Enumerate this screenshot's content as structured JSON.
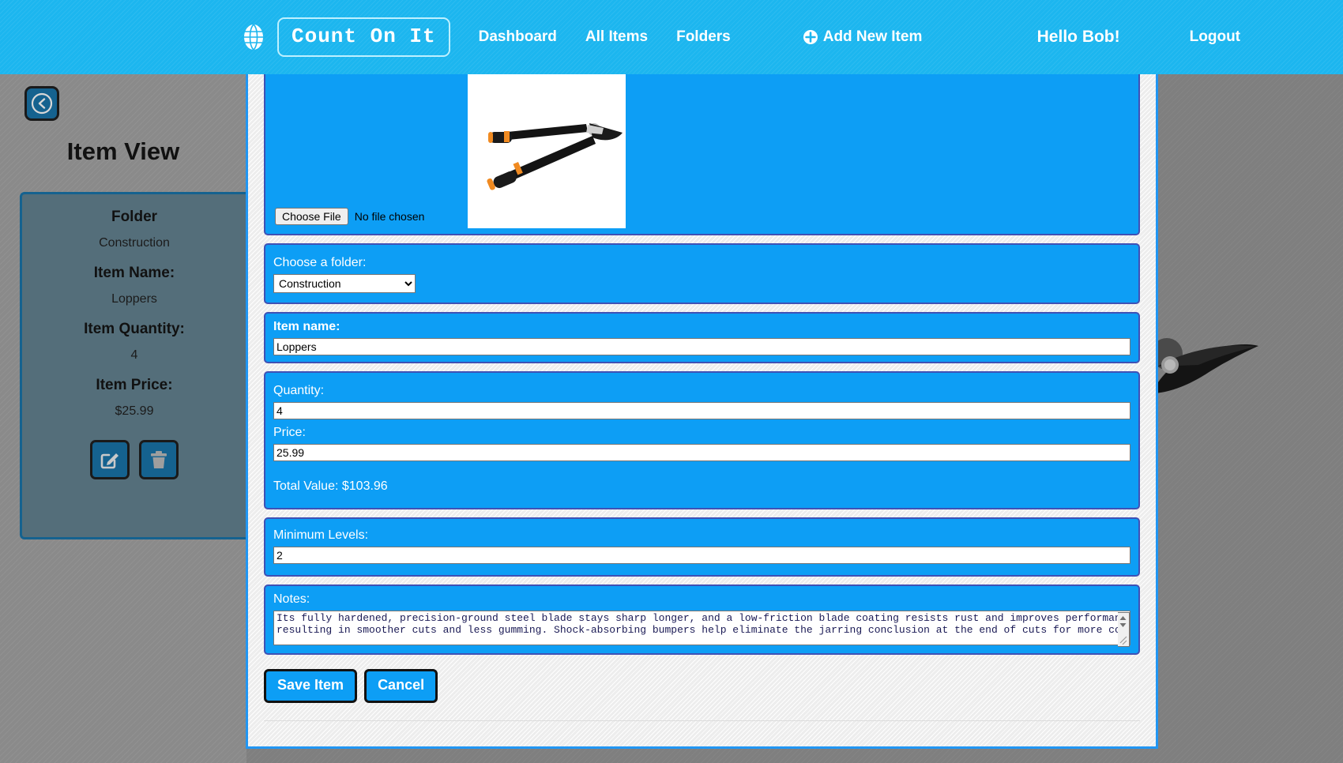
{
  "navbar": {
    "globe_icon": "globe-icon",
    "brand": "Count On It",
    "links": [
      {
        "label": "Dashboard",
        "name": "dashboard"
      },
      {
        "label": "All Items",
        "name": "all-items"
      },
      {
        "label": "Folders",
        "name": "folders"
      }
    ],
    "add_new_item": {
      "label": "Add New Item",
      "icon": "plus-circle-icon"
    },
    "greeting": "Hello Bob!",
    "logout": "Logout",
    "background_color": "#1cb6ef"
  },
  "sidebar": {
    "back_button_icon": "arrow-left-circle-icon",
    "title": "Item View",
    "card": {
      "fields": [
        {
          "label": "Folder",
          "value": "Construction"
        },
        {
          "label": "Item Name:",
          "value": "Loppers"
        },
        {
          "label": "Item Quantity:",
          "value": "4"
        },
        {
          "label": "Item Price:",
          "value": "$25.99"
        }
      ],
      "actions": [
        {
          "name": "edit-item-button",
          "icon": "pencil-square-icon"
        },
        {
          "name": "delete-item-button",
          "icon": "trash-icon"
        }
      ]
    },
    "card_color": "#546e7a",
    "border_color": "#15628f"
  },
  "form": {
    "image": {
      "file_button_label": "Choose File",
      "file_status": "No file chosen",
      "photo_alt": "loppers-product-photo"
    },
    "folder": {
      "label": "Choose a folder:",
      "selected": "Construction",
      "options": [
        "Construction"
      ]
    },
    "item_name": {
      "label": "Item name:",
      "value": "Loppers"
    },
    "quantity": {
      "label": "Quantity:",
      "value": "4"
    },
    "price": {
      "label": "Price:",
      "value": "25.99"
    },
    "total_value": "Total Value: $103.96",
    "minimum_levels": {
      "label": "Minimum Levels:",
      "value": "2"
    },
    "notes": {
      "label": "Notes:",
      "value": "Its fully hardened, precision-ground steel blade stays sharp longer, and a low-friction blade coating resists rust and improves performance,\nresulting in smoother cuts and less gumming. Shock-absorbing bumpers help eliminate the jarring conclusion at the end of cuts for more comfortable"
    },
    "save_label": "Save Item",
    "cancel_label": "Cancel",
    "panel_color": "#0d9ef5",
    "panel_border_color": "#3f51b5",
    "container_border_color": "#2196f3"
  }
}
